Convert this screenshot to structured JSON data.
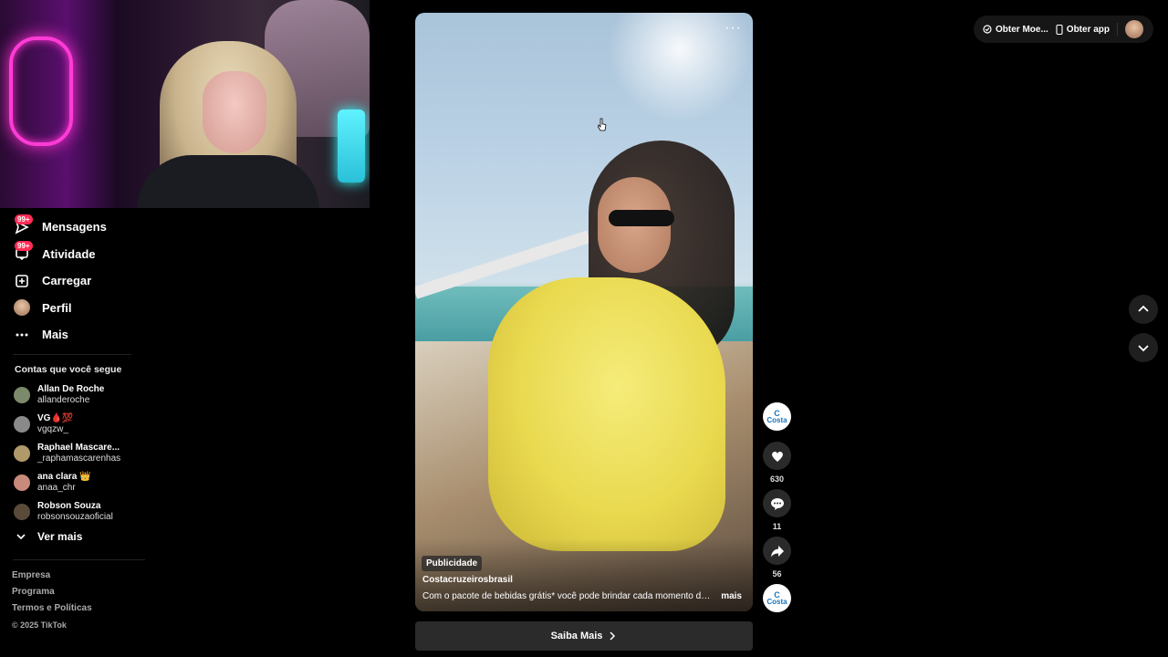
{
  "nav": {
    "items": [
      {
        "label": "Mensagens",
        "badge": "99+",
        "icon": "send-icon"
      },
      {
        "label": "Atividade",
        "badge": "99+",
        "icon": "inbox-icon"
      },
      {
        "label": "Carregar",
        "badge": "",
        "icon": "upload-icon"
      },
      {
        "label": "Perfil",
        "badge": "",
        "icon": "avatar"
      },
      {
        "label": "Mais",
        "badge": "",
        "icon": "more-icon"
      }
    ]
  },
  "following": {
    "title": "Contas que você segue",
    "accounts": [
      {
        "name": "Allan De Roche",
        "handle": "allanderoche",
        "color": "#7a8a6a"
      },
      {
        "name": "VG🩸💯",
        "handle": "vgqzw_",
        "color": "#8a8a8a"
      },
      {
        "name": "Raphael Mascare...",
        "handle": "_raphamascarenhas",
        "color": "#b09a6a"
      },
      {
        "name": "ana clara 👑",
        "handle": "anaa_chr",
        "color": "#c88a7a"
      },
      {
        "name": "Robson Souza",
        "handle": "robsonsouzaoficial",
        "color": "#5a4a3a"
      }
    ],
    "see_more": "Ver mais"
  },
  "footer": {
    "links": [
      "Empresa",
      "Programa",
      "Termos e Políticas"
    ],
    "copyright": "© 2025 TikTok"
  },
  "video": {
    "ad_tag": "Publicidade",
    "account": "Costacruzeirosbrasil",
    "caption": "Com o pacote de bebidas grátis* você pode brindar cada momento das ...",
    "more": "mais",
    "cta": "Saiba Mais"
  },
  "actions": {
    "brand": "Costa",
    "likes": "630",
    "comments": "11",
    "shares": "56"
  },
  "topbar": {
    "coins": "Obter Moe...",
    "app": "Obter app"
  },
  "colors": {
    "badge": "#ff2c55",
    "background": "#000000",
    "brand_blue": "#1a73b8"
  }
}
